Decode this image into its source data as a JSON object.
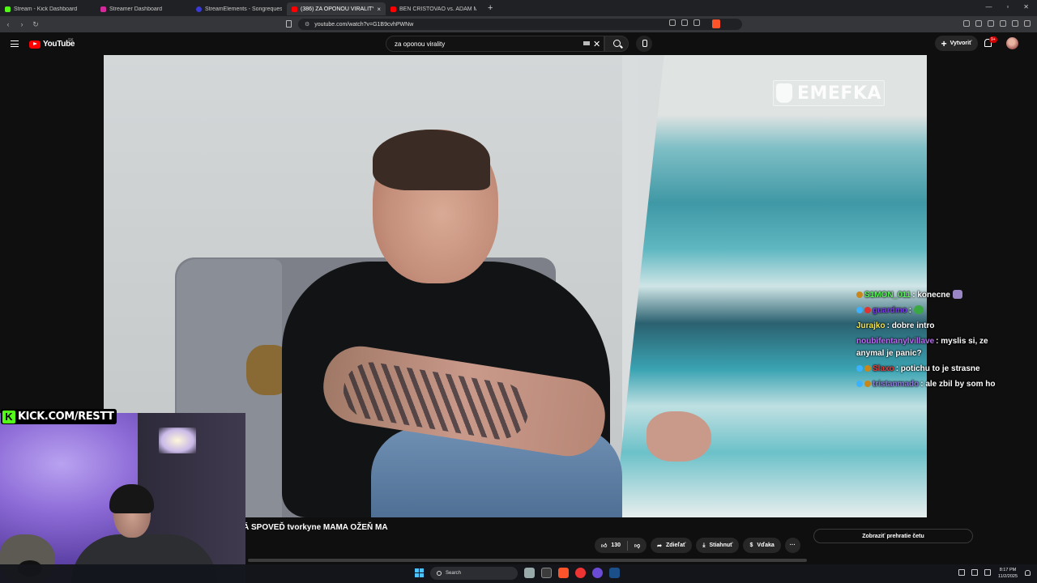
{
  "browser": {
    "tabs": [
      {
        "title": "Stream - Kick Dashboard",
        "color": "#53fc18"
      },
      {
        "title": "Streamer Dashboard",
        "color": "#d42a9c"
      },
      {
        "title": "StreamElements - Songrequest",
        "color": "#3a3ad6"
      },
      {
        "title": "(386) ZA OPONOU VIRALITY",
        "color": "#ff0000",
        "active": true
      },
      {
        "title": "BEN CRISTOVAO vs. ADAM MIŠÍK n.",
        "color": "#ff0000"
      }
    ],
    "url": "youtube.com/watch?v=G1B9cvhPWNw",
    "new_tab_label": "+",
    "close_tab_label": "×"
  },
  "youtube": {
    "logo_text": "YouTube",
    "region": "SK",
    "search_query": "za oponou virality",
    "clear_label": "✕",
    "create_label": "Vytvoriť",
    "create_plus": "+",
    "notif_count": "9+"
  },
  "video": {
    "watermark": "EMEFKA",
    "title": "Á SPOVEĎ tvorkyne MAMA OŽEŇ MA"
  },
  "chat": [
    {
      "name": "S1MON_011",
      "name_color": "#5ef05e",
      "badge_color": "#c8861b",
      "message": "konecne",
      "emote": "#9a86c4"
    },
    {
      "name": "guardmo",
      "name_color": "#7a3cf0",
      "badge_color": "#3bb1ff",
      "message": "",
      "emote": "#3aa843"
    },
    {
      "name": "Jurajko",
      "name_color": "#f7e84a",
      "badge_color": "",
      "message": "dobre intro",
      "emote": ""
    },
    {
      "name": "noubifentanylvillave",
      "name_color": "#b86cf2",
      "badge_color": "",
      "message": "myslis si, ze anymal je panic?",
      "emote": ""
    },
    {
      "name": "Slaxo",
      "name_color": "#e03c3c",
      "badge_color": "#3bb1ff",
      "message": "potichu to je strasne",
      "emote": ""
    },
    {
      "name": "tristanmado",
      "name_color": "#8a7ad8",
      "badge_color": "#3bb1ff",
      "message": "ale zbil by som ho",
      "emote": ""
    }
  ],
  "actions": {
    "likes": "130",
    "share": "Zdieľať",
    "download": "Stiahnuť",
    "thanks": "Vďaka",
    "more": "···"
  },
  "sidebar": {
    "chat_replay": "Zobraziť prehratie četu"
  },
  "webcam": {
    "kick_url": "KICK.COM/RESTT",
    "kick_k": "K"
  },
  "taskbar": {
    "search_placeholder": "Search",
    "time": "8:17 PM",
    "date": "11/2/2025"
  }
}
